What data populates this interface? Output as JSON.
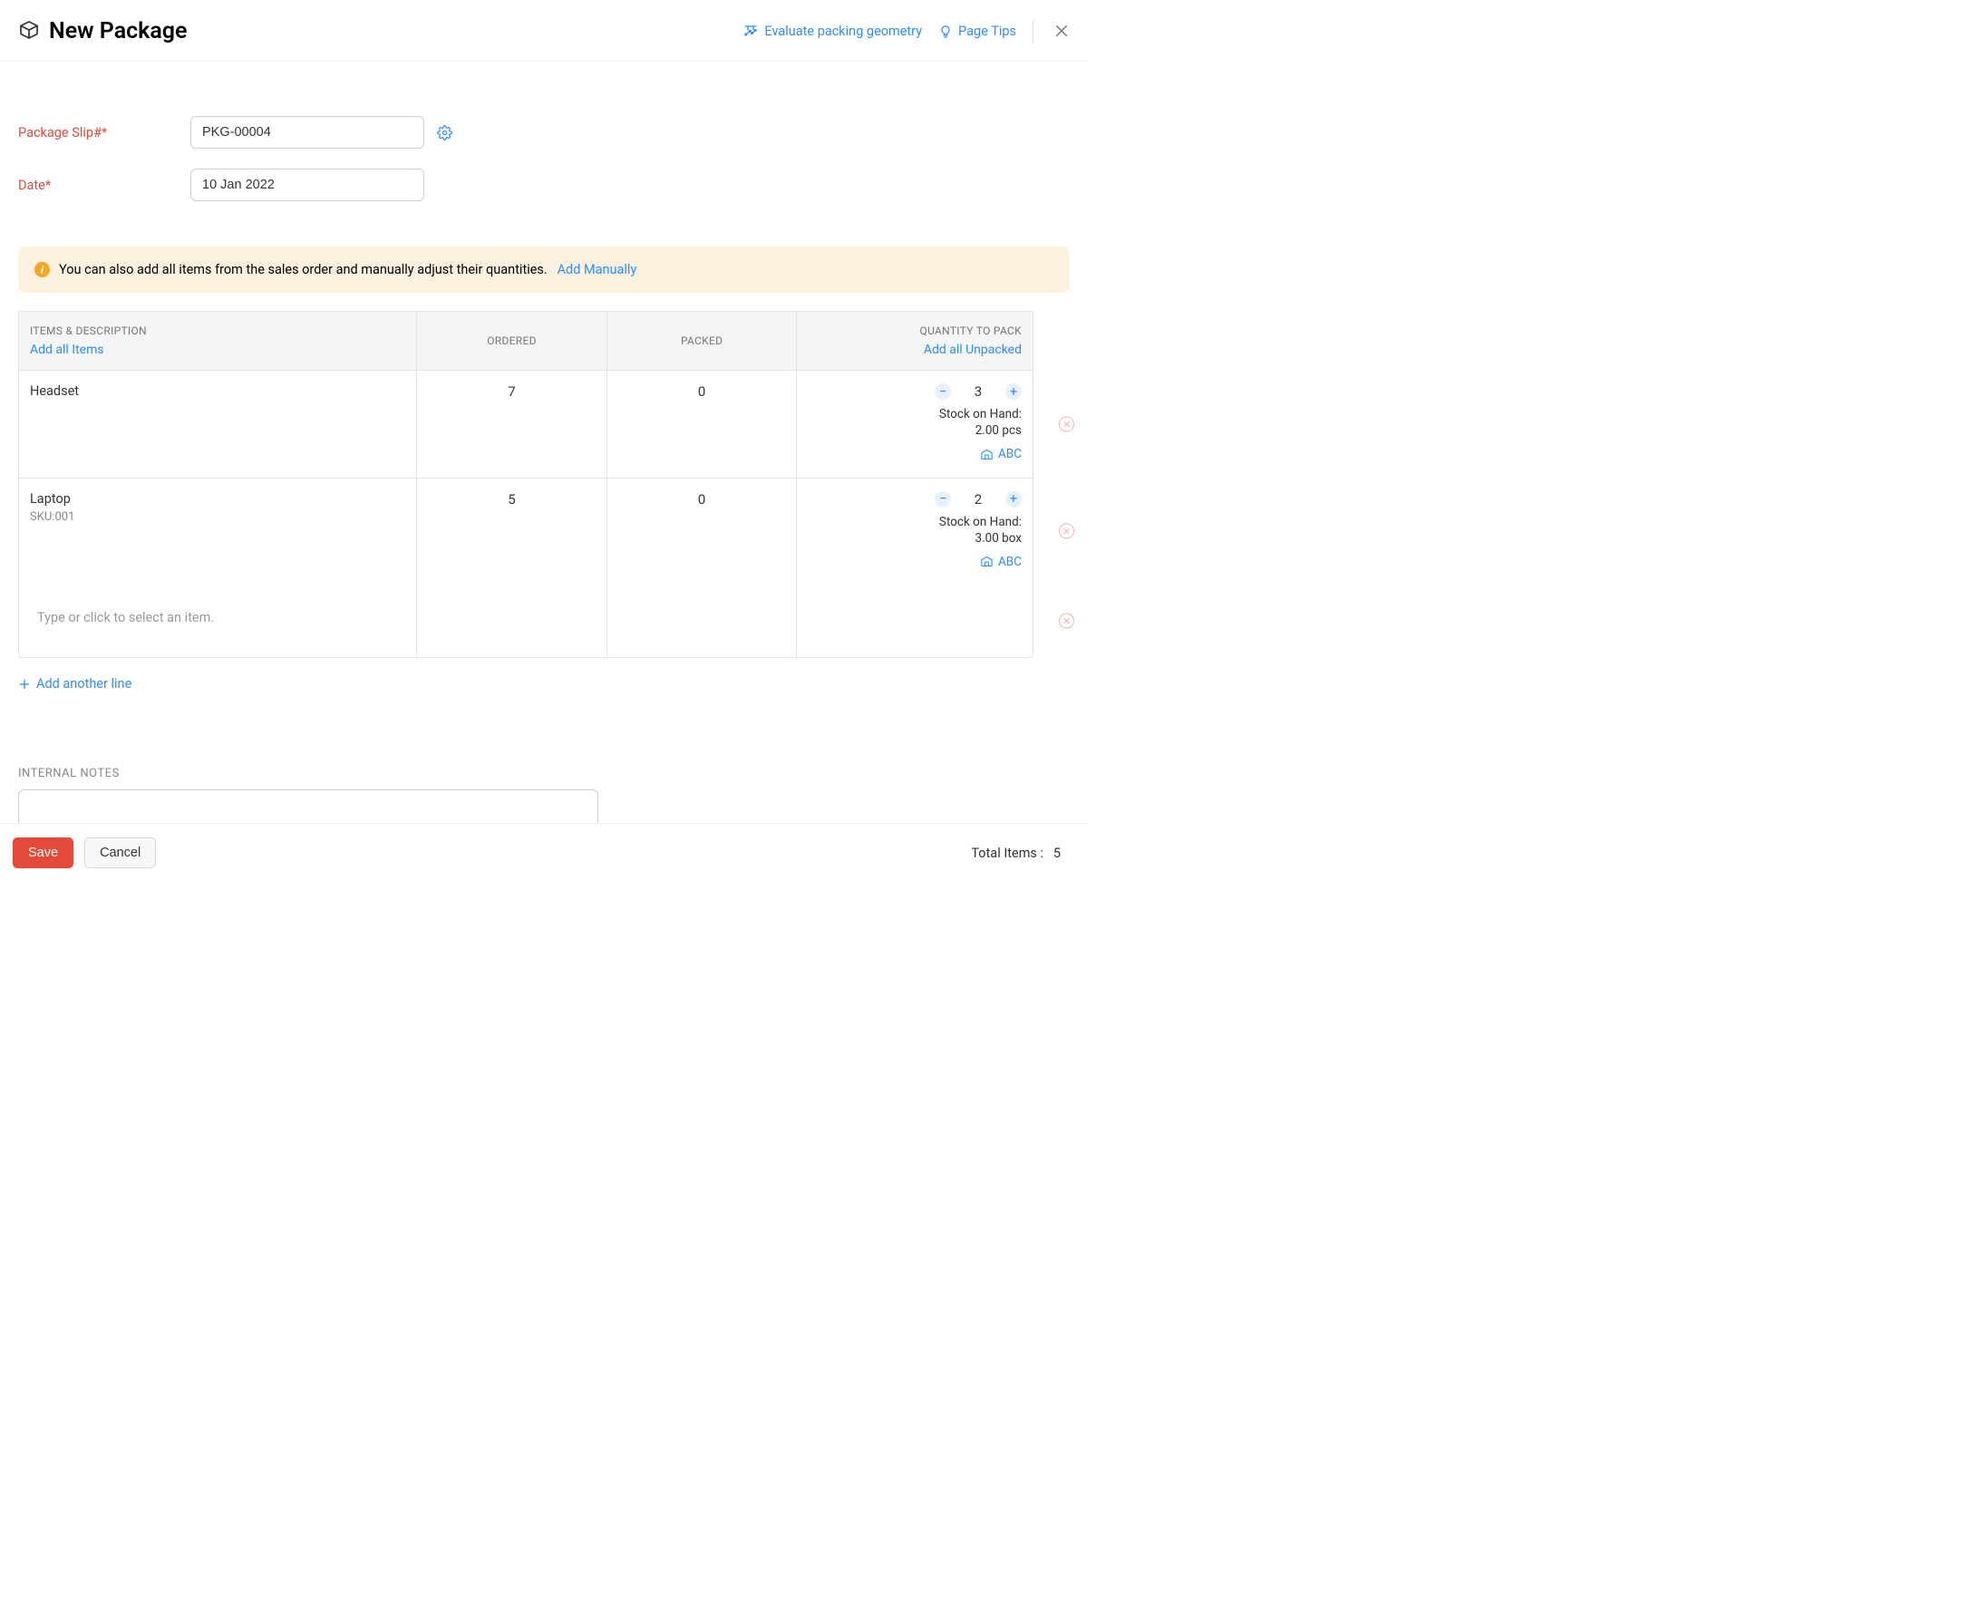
{
  "header": {
    "title": "New Package",
    "evaluate_link": "Evaluate packing geometry",
    "page_tips": "Page Tips"
  },
  "form": {
    "package_slip_label": "Package Slip#*",
    "package_slip_value": "PKG-00004",
    "date_label": "Date*",
    "date_value": "10 Jan 2022"
  },
  "banner": {
    "text": "You can also add all items from the sales order and manually adjust their quantities.",
    "link": "Add Manually"
  },
  "table": {
    "headers": {
      "items": "ITEMS & DESCRIPTION",
      "add_all_items": "Add all Items",
      "ordered": "ORDERED",
      "packed": "PACKED",
      "qty": "QUANTITY TO PACK",
      "add_all_unpacked": "Add all Unpacked"
    },
    "stock_label": "Stock on Hand:",
    "rows": [
      {
        "name": "Headset",
        "sku": "",
        "ordered": "7",
        "packed": "0",
        "qty": "3",
        "stock": "2.00 pcs",
        "warehouse": "ABC"
      },
      {
        "name": "Laptop",
        "sku": "SKU:001",
        "ordered": "5",
        "packed": "0",
        "qty": "2",
        "stock": "3.00 box",
        "warehouse": "ABC"
      }
    ],
    "placeholder": "Type or click to select an item."
  },
  "add_line": "Add another line",
  "notes": {
    "label": "INTERNAL NOTES",
    "value": ""
  },
  "footer": {
    "save": "Save",
    "cancel": "Cancel",
    "total_label": "Total Items :",
    "total_value": "5"
  }
}
